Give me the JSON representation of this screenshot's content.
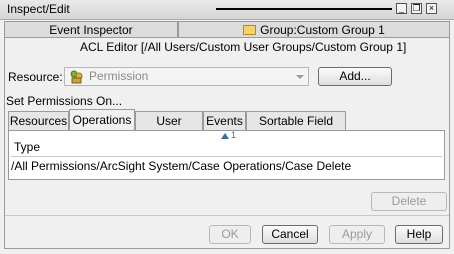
{
  "window": {
    "title": "Inspect/Edit"
  },
  "window_controls": {
    "minimize": "_",
    "restore": "❐",
    "close": "×"
  },
  "top_tabs": [
    {
      "label": "Event Inspector"
    },
    {
      "label": "Group:Custom Group 1",
      "icon": "folder-icon"
    }
  ],
  "editor": {
    "title": "ACL Editor [/All Users/Custom User Groups/Custom Group 1]"
  },
  "resource": {
    "label": "Resource:",
    "value": "Permission",
    "icon": "permission-icon",
    "add_label": "Add..."
  },
  "permissions": {
    "label": "Set Permissions On..."
  },
  "tabs": [
    {
      "label": "Resources"
    },
    {
      "label": "Operations",
      "active": true
    },
    {
      "label": "User Groups"
    },
    {
      "label": "Events"
    },
    {
      "label": "Sortable Field Sets"
    }
  ],
  "table": {
    "sort_indicator": "1",
    "column": "Type",
    "rows": [
      "/All Permissions/ArcSight System/Case Operations/Case Delete"
    ]
  },
  "delete_label": "Delete",
  "footer": {
    "ok": "OK",
    "cancel": "Cancel",
    "apply": "Apply",
    "help": "Help"
  }
}
